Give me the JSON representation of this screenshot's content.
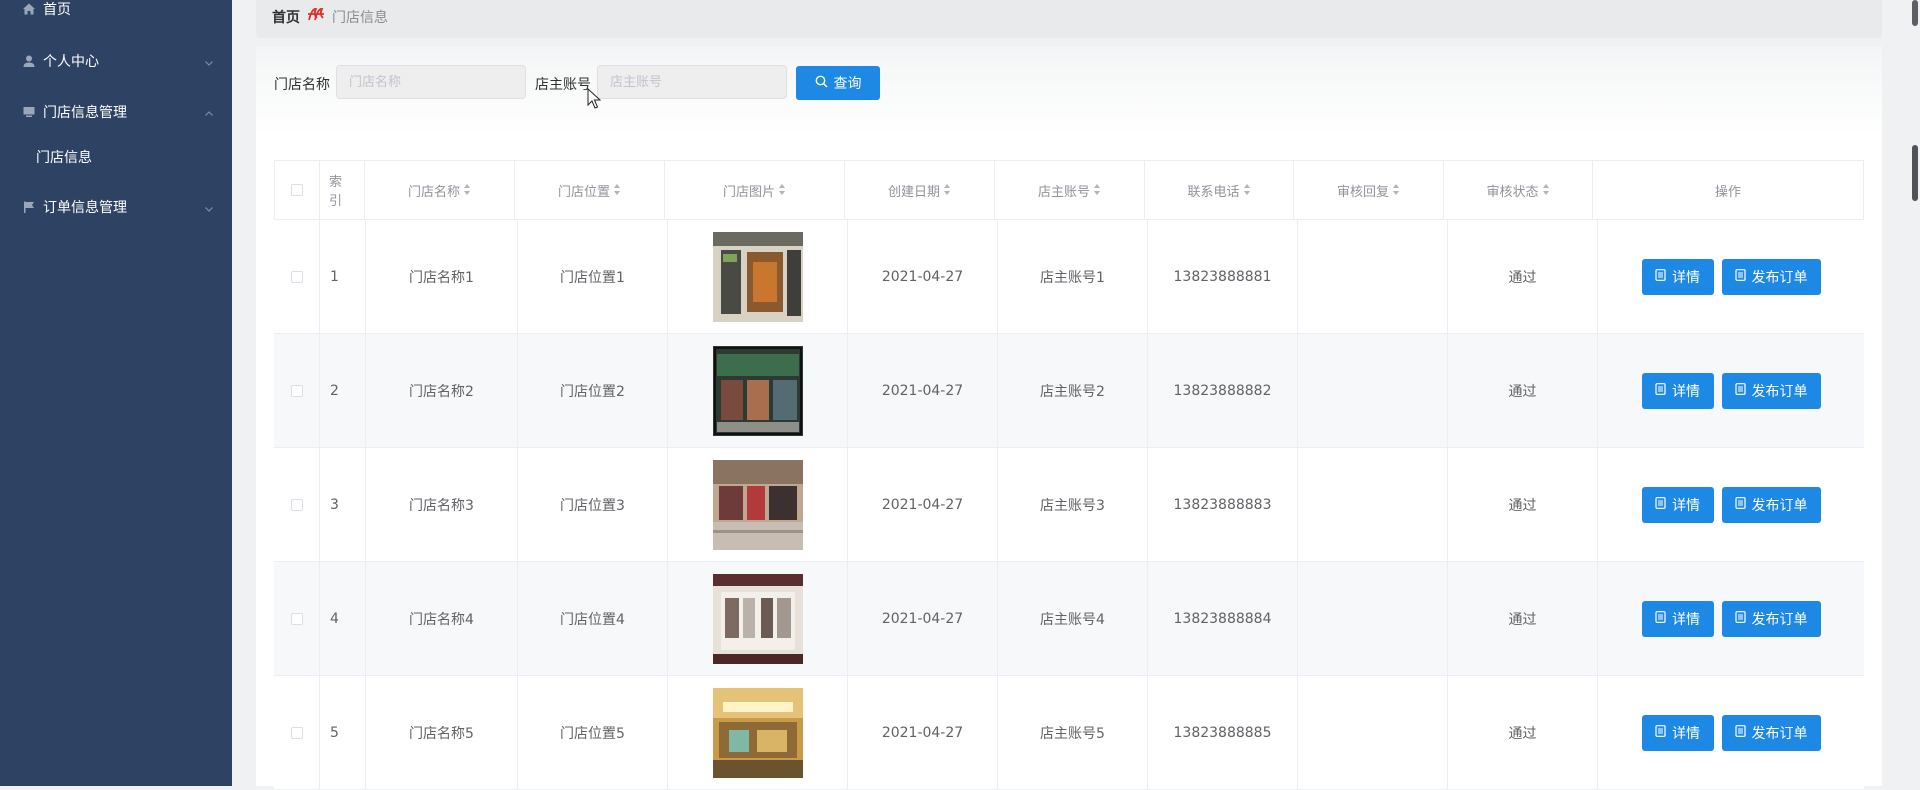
{
  "sidebar": {
    "items": [
      {
        "label": "首页",
        "icon": "home-icon"
      },
      {
        "label": "个人中心",
        "icon": "user-icon"
      },
      {
        "label": "门店信息管理",
        "icon": "monitor-icon",
        "expanded": true,
        "children": [
          {
            "label": "门店信息"
          }
        ]
      },
      {
        "label": "订单信息管理",
        "icon": "flag-icon"
      }
    ]
  },
  "breadcrumb": {
    "home": "首页",
    "current": "门店信息"
  },
  "search": {
    "store_name_label": "门店名称",
    "store_name_placeholder": "门店名称",
    "store_name_value": "",
    "owner_account_label": "店主账号",
    "owner_account_placeholder": "店主账号",
    "owner_account_value": "",
    "query_label": "查询"
  },
  "table": {
    "columns": [
      "",
      "索引",
      "门店名称",
      "门店位置",
      "门店图片",
      "创建日期",
      "店主账号",
      "联系电话",
      "审核回复",
      "审核状态",
      "操作"
    ],
    "index_header_line1": "索",
    "index_header_line2": "引",
    "rows": [
      {
        "index": "1",
        "name": "门店名称1",
        "location": "门店位置1",
        "date": "2021-04-27",
        "account": "店主账号1",
        "phone": "13823888881",
        "reply": "",
        "status": "通过"
      },
      {
        "index": "2",
        "name": "门店名称2",
        "location": "门店位置2",
        "date": "2021-04-27",
        "account": "店主账号2",
        "phone": "13823888882",
        "reply": "",
        "status": "通过"
      },
      {
        "index": "3",
        "name": "门店名称3",
        "location": "门店位置3",
        "date": "2021-04-27",
        "account": "店主账号3",
        "phone": "13823888883",
        "reply": "",
        "status": "通过"
      },
      {
        "index": "4",
        "name": "门店名称4",
        "location": "门店位置4",
        "date": "2021-04-27",
        "account": "店主账号4",
        "phone": "13823888884",
        "reply": "",
        "status": "通过"
      },
      {
        "index": "5",
        "name": "门店名称5",
        "location": "门店位置5",
        "date": "2021-04-27",
        "account": "店主账号5",
        "phone": "13823888885",
        "reply": "",
        "status": "通过"
      }
    ],
    "detail_label": "详情",
    "publish_label": "发布订单"
  },
  "colors": {
    "sidebar_bg": "#2e4263",
    "primary": "#1e88e5",
    "breadcrumb_accent": "#d9342b"
  }
}
